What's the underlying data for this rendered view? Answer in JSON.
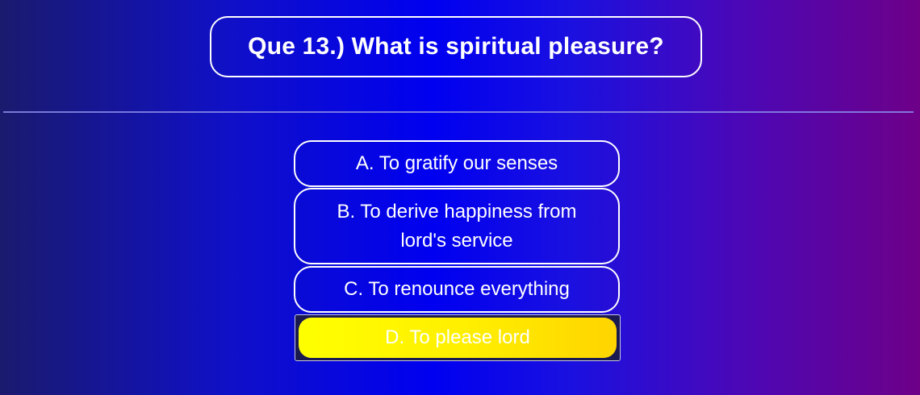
{
  "question": {
    "text": "Que 13.) What is spiritual pleasure?"
  },
  "options": [
    {
      "label": "A. To gratify our senses",
      "selected": false
    },
    {
      "label": "B. To derive happiness from lord's service",
      "selected": false
    },
    {
      "label": "C. To renounce everything",
      "selected": false
    },
    {
      "label": "D. To please lord",
      "selected": true
    }
  ],
  "colors": {
    "selected_fill": "#ffee00",
    "option_border": "#ffffff",
    "background_left": "#1a1a6e",
    "background_center": "#0000f0",
    "background_right": "#6e0088"
  }
}
